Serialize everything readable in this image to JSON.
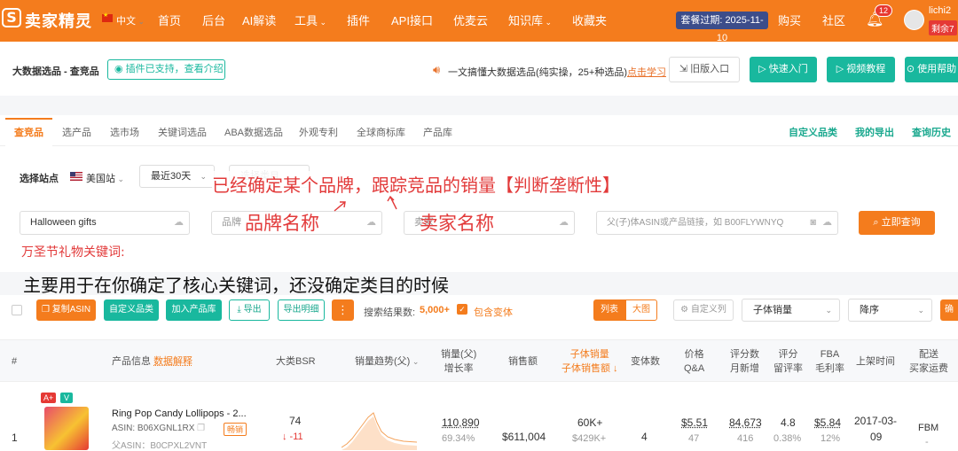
{
  "topbar": {
    "logo_mark": "S",
    "logo_text": "卖家精灵",
    "lang": "中文",
    "nav": [
      "首页",
      "后台",
      "AI解读",
      "工具",
      "插件",
      "API接口",
      "优麦云",
      "知识库",
      "收藏夹"
    ],
    "expire": "套餐过期: 2025-11-10",
    "buy": "购买",
    "community": "社区",
    "notif_count": "12",
    "username": "lichi2",
    "remaining": "剩余7"
  },
  "header": {
    "breadcrumb": "大数据选品 - 查竞品",
    "plugin_notice": "插件已支持，查看介绍",
    "announcement": "一文搞懂大数据选品(纯实操，25+种选品)",
    "announcement_link": "点击学习",
    "old_version": "旧版入口",
    "quick_start": "快速入门",
    "video_tutorial": "视频教程",
    "help": "使用帮助"
  },
  "tabs": {
    "left": [
      "查竞品",
      "选产品",
      "选市场",
      "关键词选品",
      "ABA数据选品",
      "外观专利",
      "全球商标库",
      "产品库"
    ],
    "right": [
      "自定义品类",
      "我的导出",
      "查询历史"
    ]
  },
  "filters": {
    "site_label": "选择站点",
    "site_value": "美国站",
    "period": "最近30天",
    "category_placeholder": "选择类目",
    "keyword_value": "Halloween gifts",
    "brand_placeholder": "品牌",
    "seller_placeholder": "卖家",
    "asin_placeholder": "父(子)体ASIN或产品链接，如 B00FLYWNYQ",
    "query_button": "立即查询"
  },
  "annotations": {
    "headline": "已经确定某个品牌，跟踪竞品的销量【判断垄断性】",
    "brand_label": "品牌名称",
    "seller_label": "卖家名称",
    "keyword_label": "万圣节礼物关键词:",
    "note": "主要用于在你确定了核心关键词，还没确定类目的时候"
  },
  "toolbar": {
    "copy_asin": "复制ASIN",
    "custom_category": "自定义品类",
    "add_library": "加入产品库",
    "export": "导出",
    "export_detail": "导出明细",
    "result_label": "搜索结果数:",
    "result_count": "5,000+",
    "include_variants": "包含变体",
    "view_list": "列表",
    "view_large": "大图",
    "custom_columns": "自定义列",
    "sort_field": "子体销量",
    "sort_order": "降序",
    "more": "确"
  },
  "table": {
    "headers": {
      "index": "#",
      "product": "产品信息",
      "product_link": "数据解释",
      "bsr": "大类BSR",
      "trend": "销量趋势(父)",
      "sales_parent": "销量(父)",
      "sales_parent_sub": "增长率",
      "revenue": "销售额",
      "child_sales": "子体销量",
      "child_revenue": "子体销售额",
      "variants": "变体数",
      "price": "价格",
      "price_sub": "Q&A",
      "ratings": "评分数",
      "ratings_sub": "月新增",
      "rating": "评分",
      "rating_sub": "留评率",
      "fba": "FBA",
      "fba_sub": "毛利率",
      "launch": "上架时间",
      "delivery": "配送",
      "delivery_sub": "买家运费"
    },
    "rows": [
      {
        "index": "1",
        "badge_a": "A+",
        "badge_v": "V",
        "title": "Ring Pop Candy Lollipops - 2...",
        "asin": "ASIN: B06XGNL1RX",
        "parent_asin": "父ASIN：B0CPXL2VNT",
        "tag": "畅销",
        "bsr": "74",
        "bsr_change": "↓ -11",
        "sales": "110,890",
        "growth": "69.34%",
        "revenue": "$611,004",
        "child_sales": "60K+",
        "child_revenue": "$429K+",
        "variants": "4",
        "price": "$5.51",
        "qa": "47",
        "ratings": "84,673",
        "ratings_new": "416",
        "rating": "4.8",
        "review_rate": "0.38%",
        "fba": "$5.84",
        "margin": "12%",
        "launch_date": "2017-03-",
        "launch_day": "09",
        "delivery": "FBM",
        "shipping": "-"
      }
    ]
  },
  "colors": {
    "brand": "#f47c1d",
    "green": "#19b89e",
    "annotation": "#e23a3a"
  }
}
